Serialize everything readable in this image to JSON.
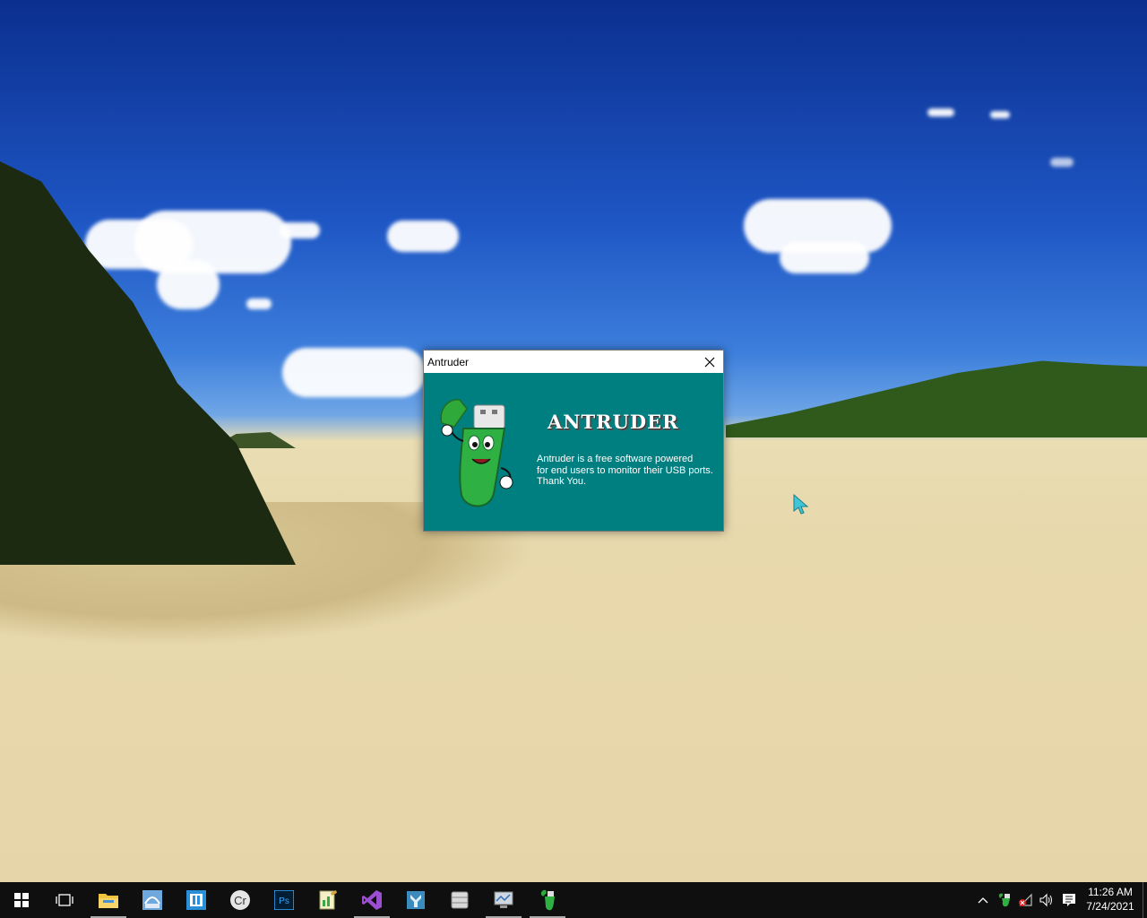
{
  "dialog": {
    "title": "Antruder",
    "logo_text": "ANTRUDER",
    "description_lines": [
      "Antruder is a free software powered",
      "for end users to monitor their USB ports.",
      "Thank You."
    ],
    "background_color": "#007f80"
  },
  "taskbar": {
    "apps": [
      {
        "name": "start-icon"
      },
      {
        "name": "task-view-icon"
      },
      {
        "name": "file-explorer-icon",
        "active": true
      },
      {
        "name": "network-app-icon"
      },
      {
        "name": "bracket-app-icon"
      },
      {
        "name": "cr-app-icon"
      },
      {
        "name": "photoshop-icon",
        "label": "Ps"
      },
      {
        "name": "notepad-chart-icon"
      },
      {
        "name": "visual-studio-icon",
        "active": true
      },
      {
        "name": "tool-app-icon"
      },
      {
        "name": "database-app-icon"
      },
      {
        "name": "monitor-app-icon",
        "active": true
      },
      {
        "name": "antruder-app-icon",
        "active": true
      }
    ],
    "clock": {
      "time": "11:26 AM",
      "date": "7/24/2021"
    }
  }
}
